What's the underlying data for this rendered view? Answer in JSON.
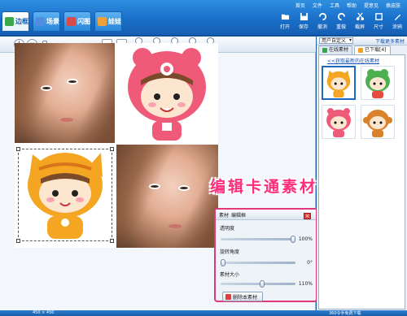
{
  "tabs": [
    {
      "label": "边框",
      "badge": "",
      "color": "#3aa84a"
    },
    {
      "label": "场景",
      "badge": "",
      "color": "#4f8de0"
    },
    {
      "label": "闪图",
      "badge": "",
      "color": "#d94a4a"
    },
    {
      "label": "娃娃",
      "badge": "",
      "color": "#f0a23a"
    }
  ],
  "menu": [
    "首页",
    "文件",
    "工具",
    "帮助",
    "提意见",
    "换皮肤"
  ],
  "tools_right": [
    "打开",
    "保存",
    "撤消",
    "重做",
    "截屏",
    "尺寸",
    "涂鸦"
  ],
  "edit_tools": [
    "撤销",
    "重做",
    "原图",
    "对比",
    "预览"
  ],
  "caption": "编辑卡通素材",
  "panel": {
    "title": "素材",
    "subtitle": "编辑框",
    "opacity_label": "透明度",
    "opacity_value": "100%",
    "opacity_level": 1.0,
    "rotate_label": "旋转角度",
    "rotate_value": "0°",
    "rotate_level": 0.0,
    "size_label": "素材大小",
    "size_value": "110%",
    "size_level": 0.55,
    "delete_label": "删除本素材"
  },
  "right_panel": {
    "category": "用户自定义",
    "more_link": "下载更多素材",
    "tab_online": "在线素材",
    "tab_downloaded": "已下载[4]",
    "favorite_link": "<<获取最新的在线素材"
  },
  "status": {
    "size": "450 × 450",
    "right_text": "360令手免费下载"
  },
  "colors": {
    "accent": "#1a6fc9",
    "highlight": "#e0387a",
    "caption": "#ff2d7a"
  }
}
